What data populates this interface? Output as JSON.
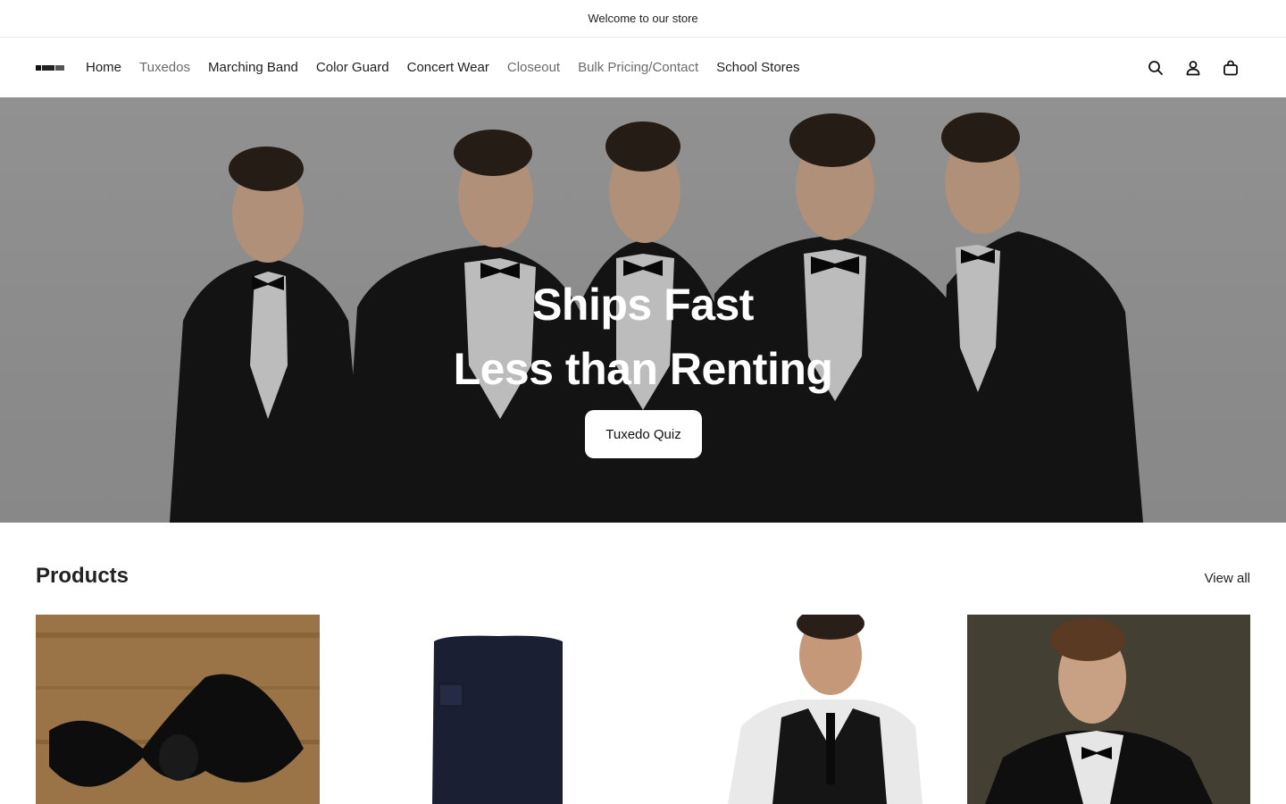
{
  "announcement": "Welcome to our store",
  "nav": {
    "items": [
      {
        "label": "Home",
        "muted": false
      },
      {
        "label": "Tuxedos",
        "muted": true
      },
      {
        "label": "Marching Band",
        "muted": false
      },
      {
        "label": "Color Guard",
        "muted": false
      },
      {
        "label": "Concert Wear",
        "muted": false
      },
      {
        "label": "Closeout",
        "muted": true
      },
      {
        "label": "Bulk Pricing/Contact",
        "muted": true
      },
      {
        "label": "School Stores",
        "muted": false
      }
    ],
    "icons": [
      "search-icon",
      "account-icon",
      "cart-icon"
    ]
  },
  "hero": {
    "line1": "Ships Fast",
    "line2": "Less than Renting",
    "button": "Tuxedo Quiz"
  },
  "products": {
    "title": "Products",
    "view_all": "View all"
  },
  "colors": {
    "accent": "#111111",
    "hero_bg": "#a0a0a0"
  }
}
